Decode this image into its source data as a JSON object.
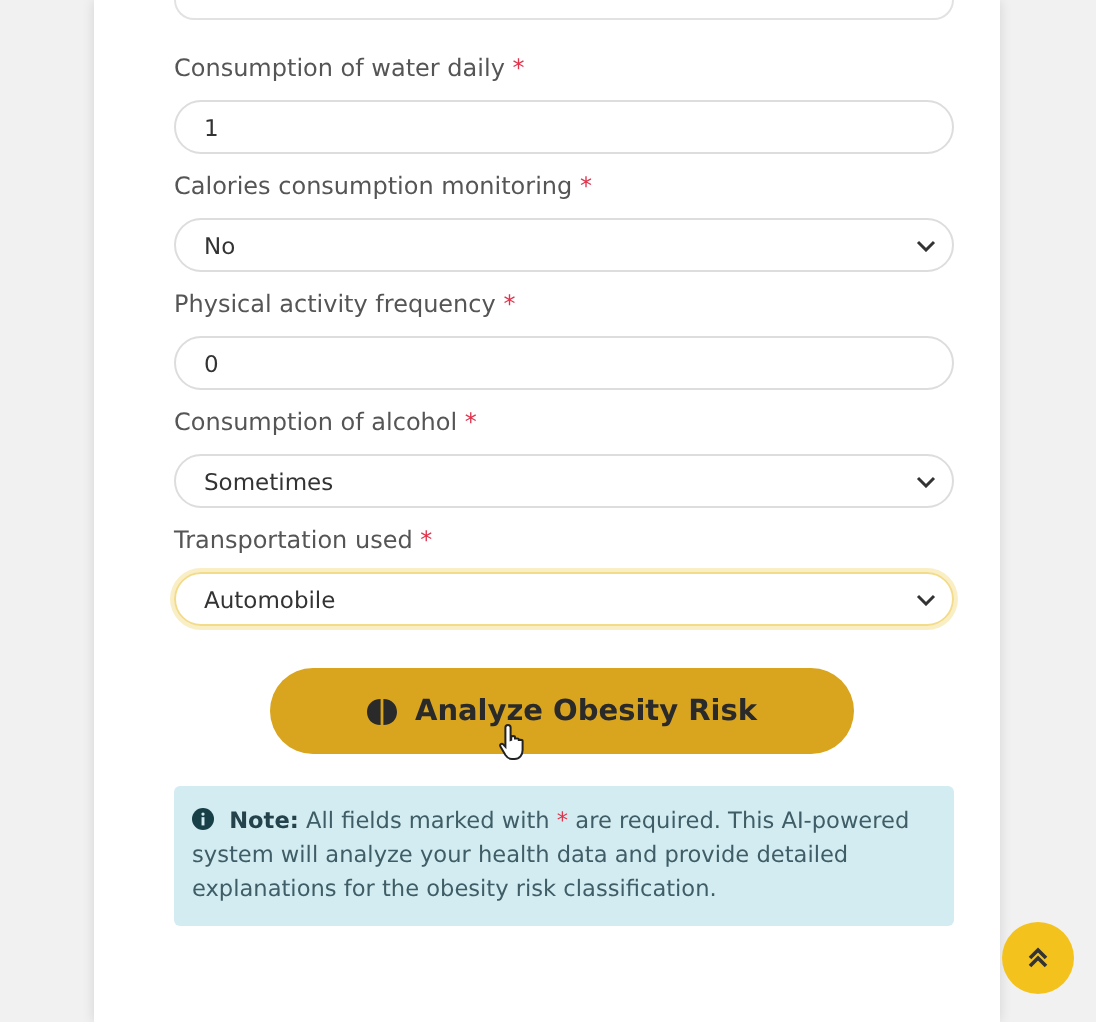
{
  "fields": [
    {
      "label": "Consumption of water daily",
      "required_mark": "*",
      "kind": "input",
      "value": "1",
      "focused": false
    },
    {
      "label": "Calories consumption monitoring",
      "required_mark": "*",
      "kind": "select",
      "value": "No",
      "focused": false
    },
    {
      "label": "Physical activity frequency",
      "required_mark": "*",
      "kind": "input",
      "value": "0",
      "focused": false
    },
    {
      "label": "Consumption of alcohol",
      "required_mark": "*",
      "kind": "select",
      "value": "Sometimes",
      "focused": false
    },
    {
      "label": "Transportation used",
      "required_mark": "*",
      "kind": "select",
      "value": "Automobile",
      "focused": true
    }
  ],
  "submit_button": {
    "label": "Analyze Obesity Risk"
  },
  "note": {
    "lead": "Note:",
    "before_mark": "All fields marked with ",
    "mark": "*",
    "after_mark": " are required. This AI-powered system will analyze your health data and provide detailed explanations for the obesity risk classification."
  }
}
